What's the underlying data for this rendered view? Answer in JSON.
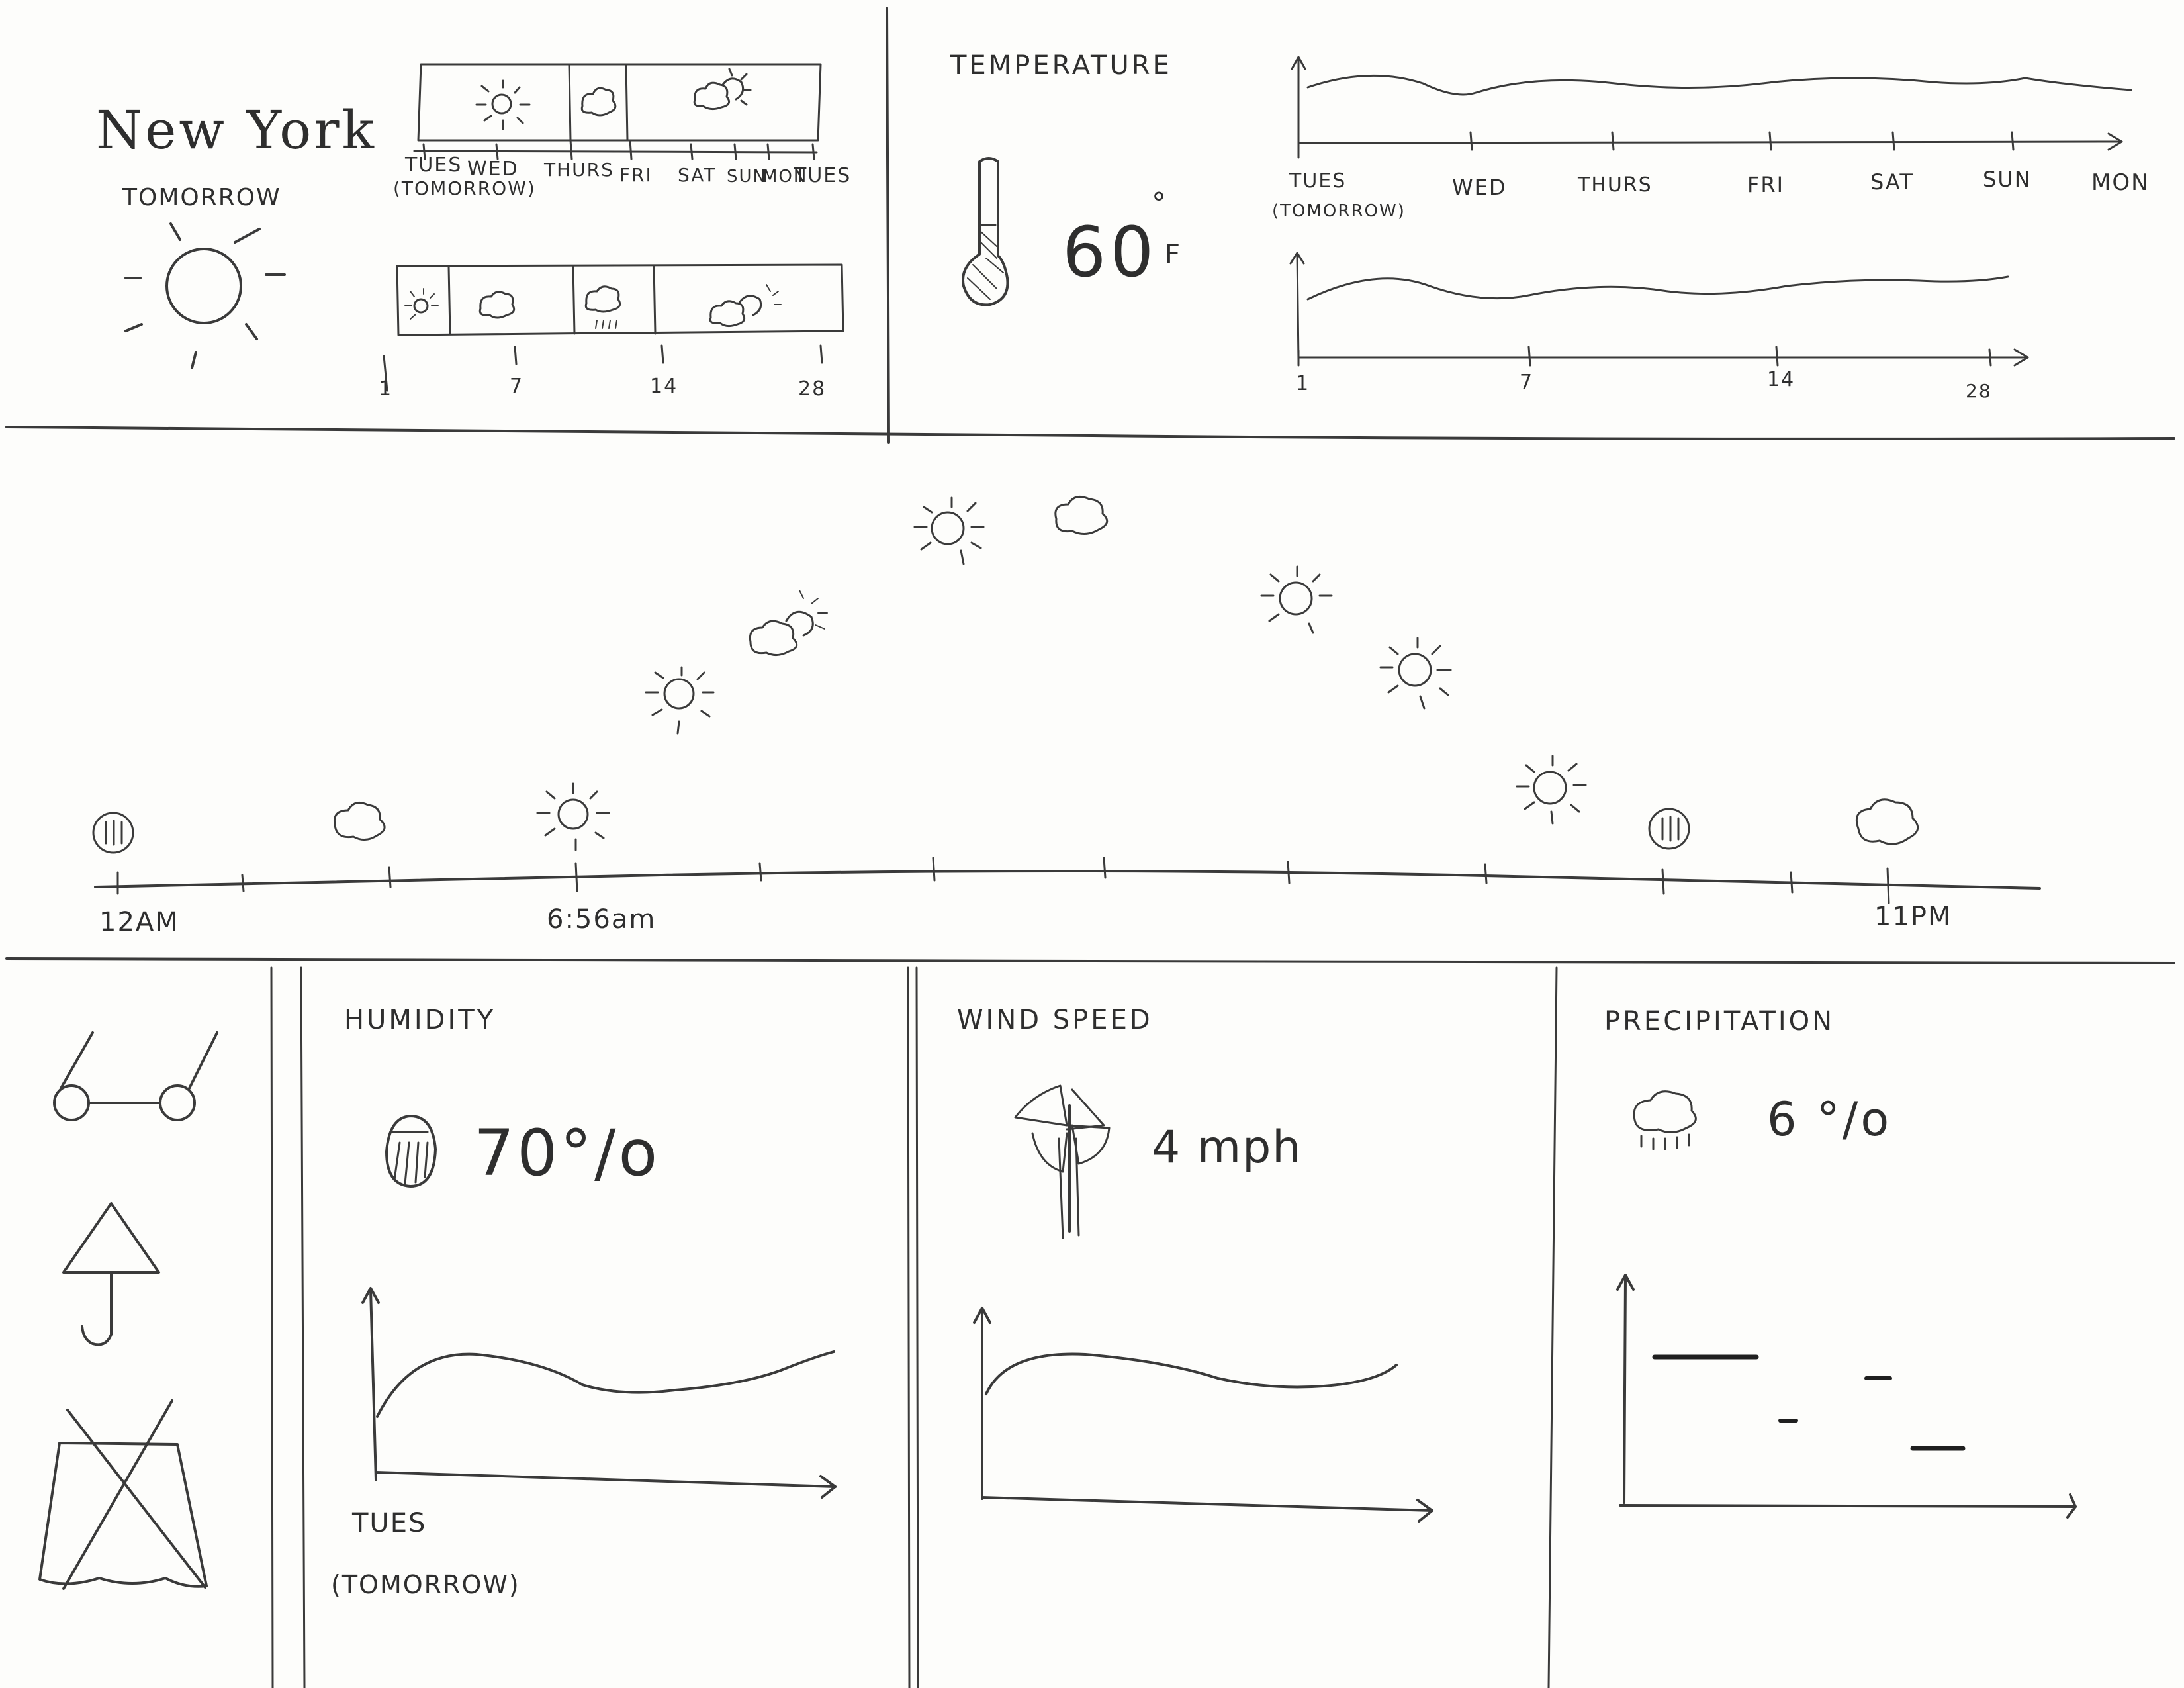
{
  "location": {
    "city": "New York",
    "tomorrow_label": "TOMORROW"
  },
  "forecast_week": {
    "days": [
      "TUES",
      "(TOMORROW)",
      "WED",
      "THURS",
      "FRI",
      "SAT",
      "SUN",
      "MON",
      "TUES"
    ]
  },
  "forecast_month": {
    "ticks": [
      "1",
      "7",
      "14",
      "28"
    ]
  },
  "temperature": {
    "title": "TEMPERATURE",
    "value": "60",
    "degree": "°",
    "unit": "F",
    "week_ticks": [
      "TUES",
      "(TOMORROW)",
      "WED",
      "THURS",
      "FRI",
      "SAT",
      "SUN",
      "MON"
    ],
    "month_ticks": [
      "1",
      "7",
      "14",
      "28"
    ]
  },
  "hourly": {
    "start_label": "12AM",
    "sunrise_label": "6:56am",
    "end_label": "11PM"
  },
  "humidity": {
    "title": "HUMIDITY",
    "value": "70°/o",
    "axis_label_1": "TUES",
    "axis_label_2": "(TOMORROW)"
  },
  "wind": {
    "title": "WIND SPEED",
    "value": "4 mph"
  },
  "precipitation": {
    "title": "PRECIPITATION",
    "value": "6 °/o"
  },
  "icons": {
    "weather": [
      "sun-icon",
      "cloud-icon",
      "partly-cloudy-icon",
      "rain-icon"
    ],
    "sidebar": [
      "glasses-icon",
      "umbrella-icon",
      "tent-icon"
    ]
  }
}
